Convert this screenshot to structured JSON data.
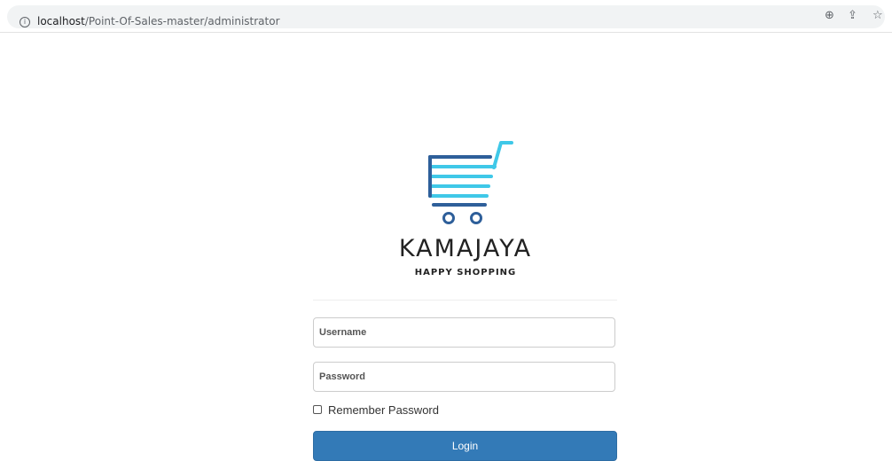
{
  "browser": {
    "url_host": "localhost",
    "url_path": "/Point-Of-Sales-master/administrator",
    "info_icon": "info-icon",
    "icons": [
      "zoom-icon",
      "share-icon",
      "bookmark-star-icon"
    ]
  },
  "logo": {
    "icon": "shopping-cart-icon",
    "brand_name": "KAMAJAYA",
    "tagline": "HAPPY SHOPPING",
    "colors": {
      "dark_blue": "#2e5f9a",
      "light_blue": "#3fc8e8",
      "text": "#222222"
    }
  },
  "form": {
    "username_placeholder": "Username",
    "password_placeholder": "Password",
    "remember_label": "Remember Password",
    "remember_checked": false,
    "login_label": "Login",
    "button_color": "#337ab7"
  }
}
